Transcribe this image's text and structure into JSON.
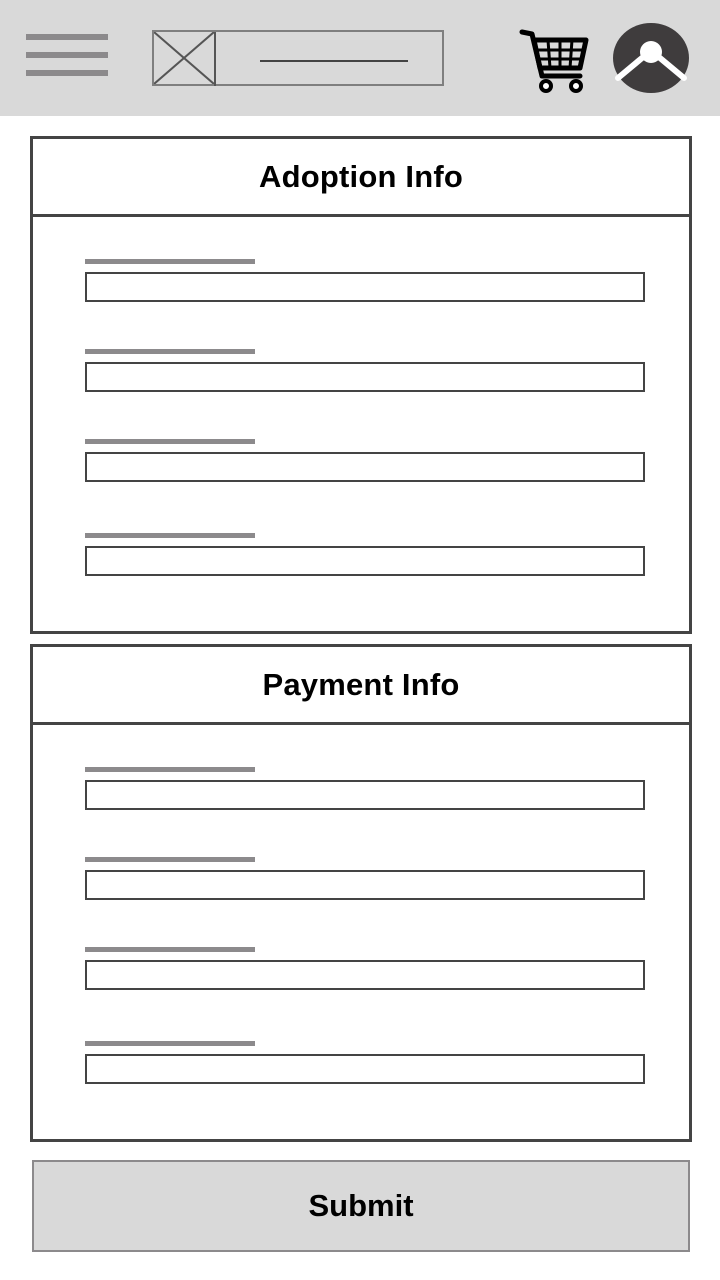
{
  "header": {
    "menu_icon": "hamburger-menu-icon",
    "logo_icon": "image-placeholder-icon",
    "cart_icon": "shopping-cart-icon",
    "avatar_icon": "user-avatar-icon"
  },
  "sections": [
    {
      "title": "Adoption Info",
      "fields": [
        {
          "value": "",
          "placeholder": ""
        },
        {
          "value": "",
          "placeholder": ""
        },
        {
          "value": "",
          "placeholder": ""
        },
        {
          "value": "",
          "placeholder": ""
        }
      ]
    },
    {
      "title": "Payment Info",
      "fields": [
        {
          "value": "",
          "placeholder": ""
        },
        {
          "value": "",
          "placeholder": ""
        },
        {
          "value": "",
          "placeholder": ""
        },
        {
          "value": "",
          "placeholder": ""
        }
      ]
    }
  ],
  "submit_label": "Submit",
  "colors": {
    "header_bg": "#d9d9d9",
    "border": "#444444",
    "label_bar": "#8c8a8c",
    "button_bg": "#d9d9d9"
  }
}
